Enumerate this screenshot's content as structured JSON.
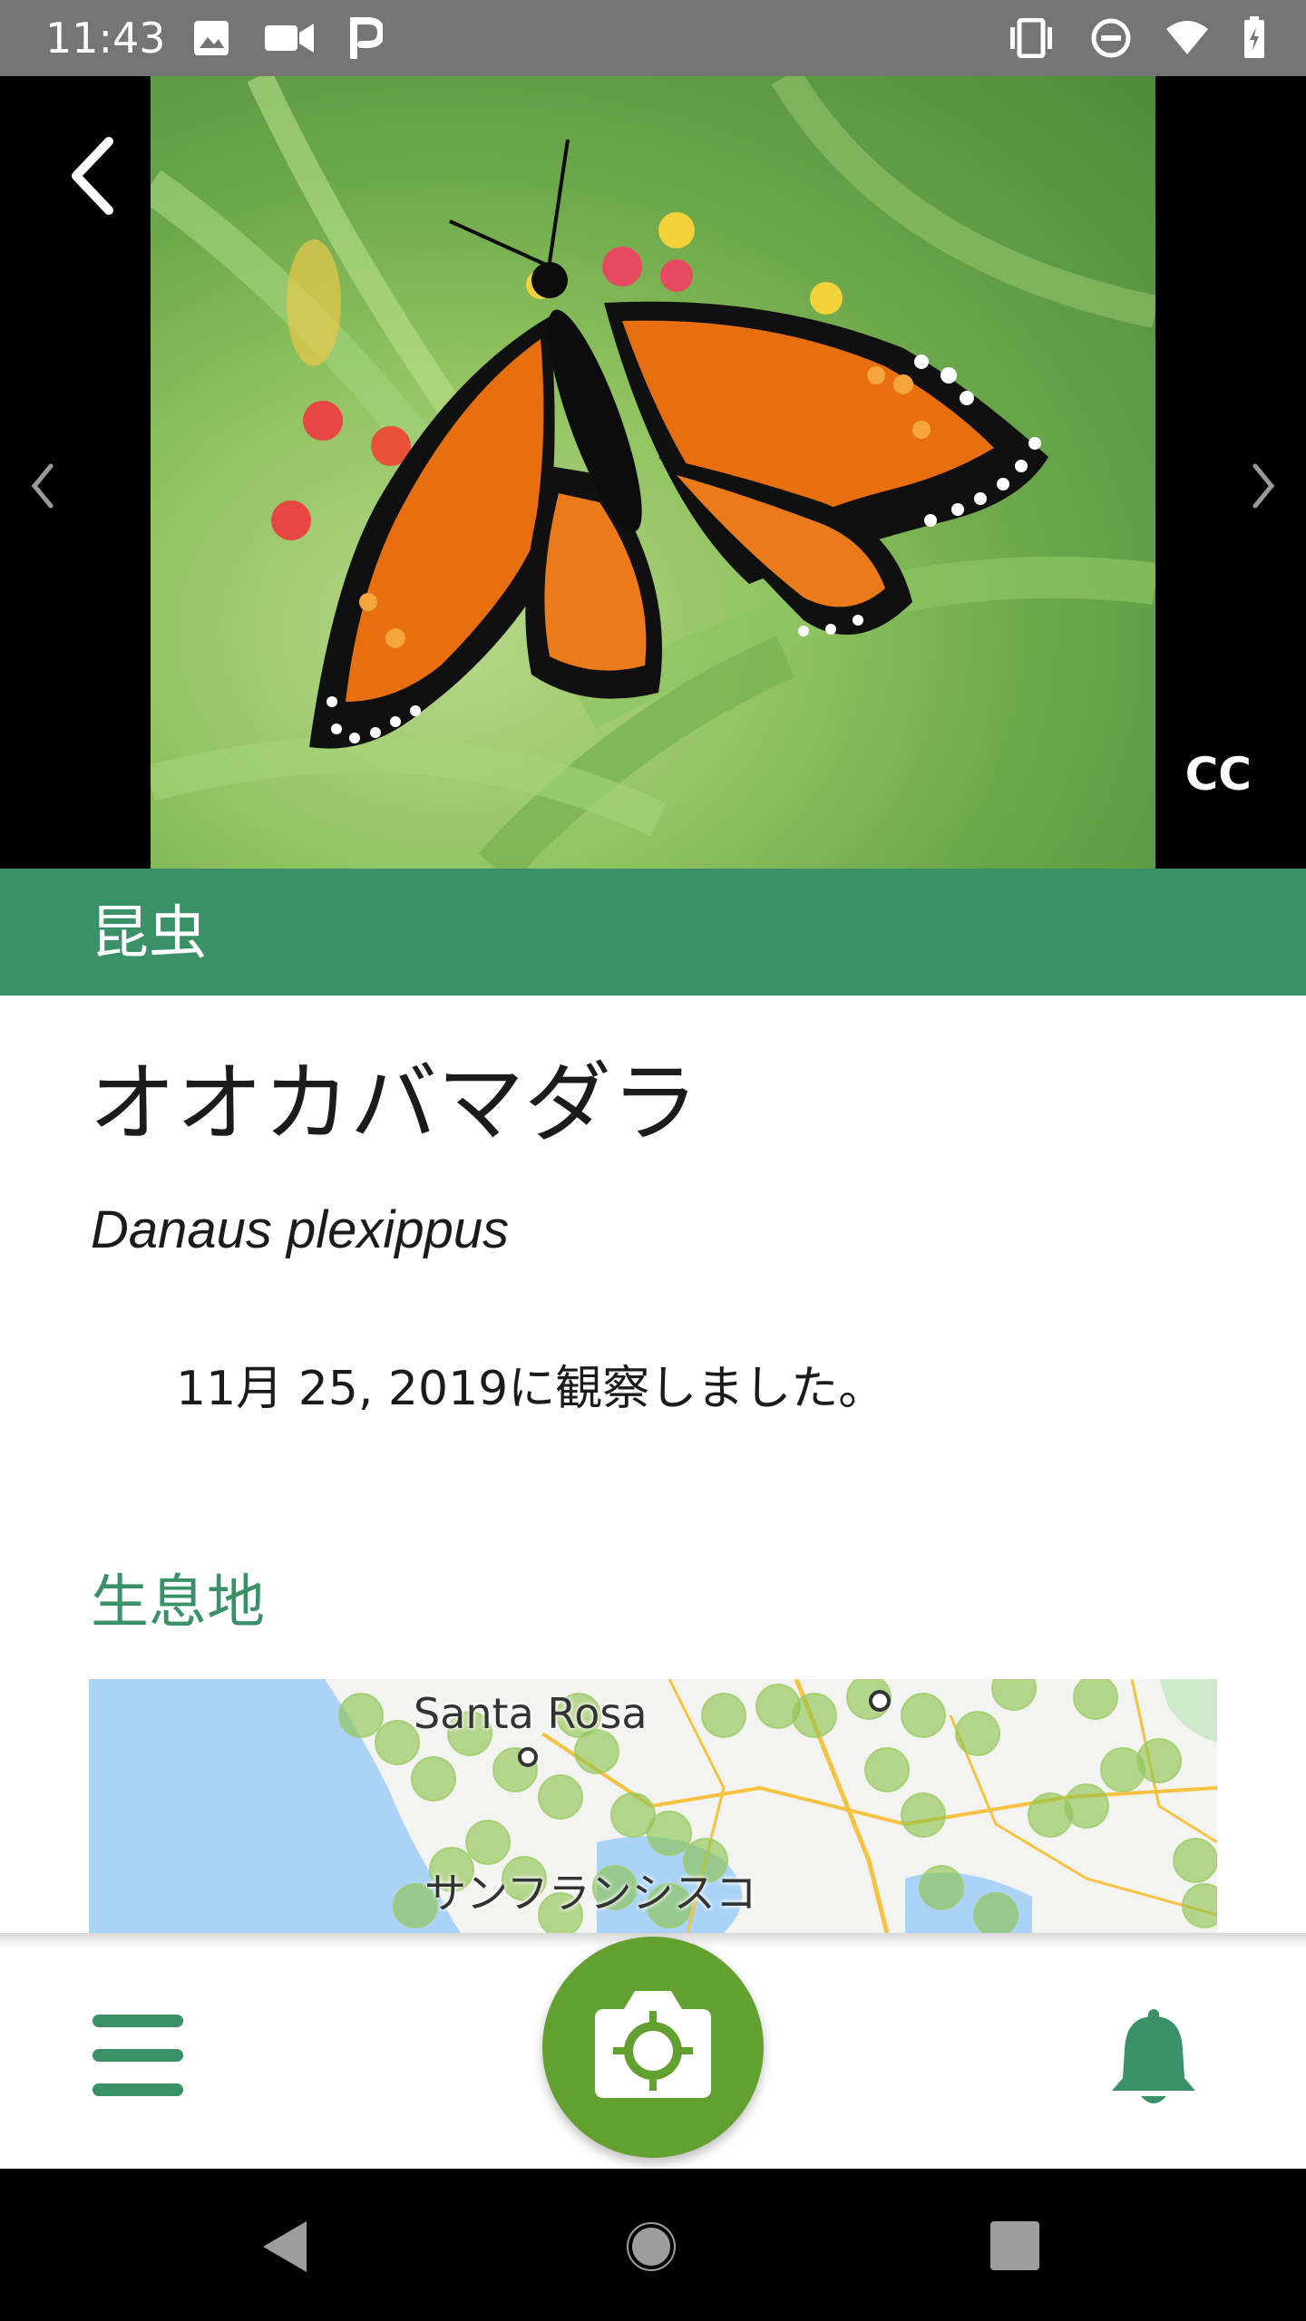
{
  "status_bar": {
    "time": "11:43",
    "left_icons": [
      "image-icon",
      "video-icon",
      "p-app-icon"
    ],
    "right_icons": [
      "vibrate-icon",
      "do-not-disturb-icon",
      "wifi-icon",
      "battery-icon"
    ]
  },
  "photo": {
    "subject": "monarch butterfly on milkweed",
    "license_badge": "CC"
  },
  "category": {
    "label": "昆虫",
    "color": "#3a9168"
  },
  "species": {
    "common_name": "オオカバマダラ",
    "scientific_name": "Danaus plexippus"
  },
  "observation": {
    "date_text": "11月 25, 2019に観察しました。"
  },
  "habitat": {
    "title": "生息地",
    "map_labels": {
      "city1": "Santa Rosa",
      "city2": "サンフランシスコ"
    }
  },
  "bottom_nav": {
    "accent": "#3a9168",
    "camera_color": "#62a12f",
    "items": [
      "menu-icon",
      "camera-icon",
      "bell-icon"
    ]
  },
  "system_nav": {
    "items": [
      "back-icon",
      "home-icon",
      "recents-icon"
    ]
  }
}
